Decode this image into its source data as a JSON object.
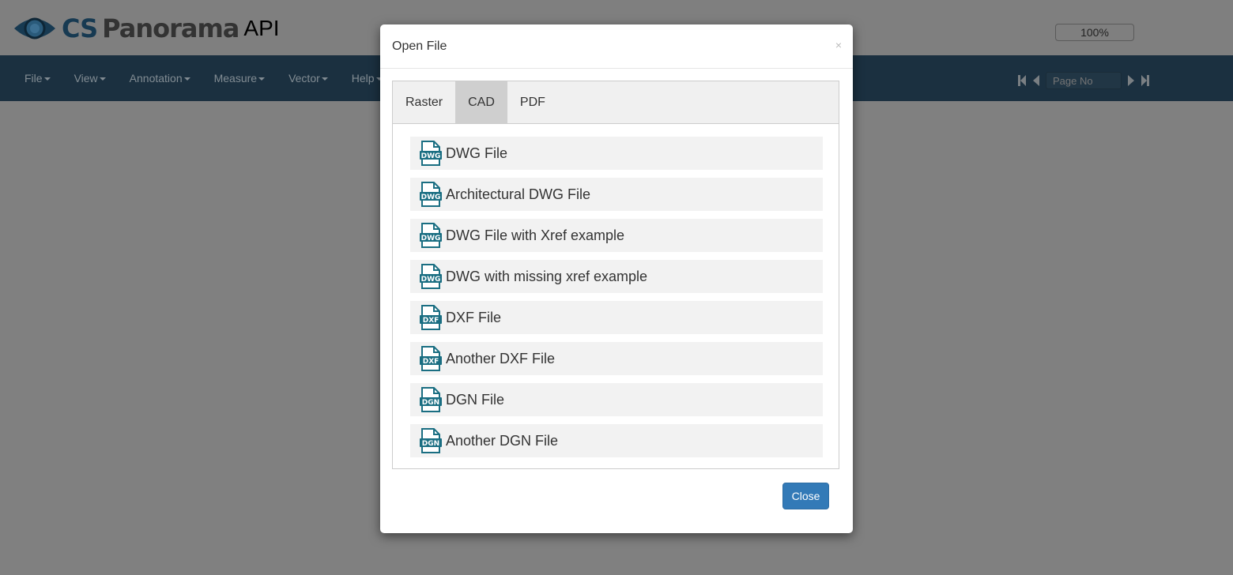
{
  "header": {
    "logo": {
      "cs": "CS",
      "panorama": "Panorama",
      "api": "API"
    },
    "zoom_level": "100%"
  },
  "navbar": {
    "menu": [
      {
        "label": "File"
      },
      {
        "label": "View"
      },
      {
        "label": "Annotation"
      },
      {
        "label": "Measure"
      },
      {
        "label": "Vector"
      },
      {
        "label": "Help"
      }
    ],
    "page_input_placeholder": "Page No"
  },
  "modal": {
    "title": "Open File",
    "close_symbol": "×",
    "tabs": [
      {
        "label": "Raster",
        "active": false
      },
      {
        "label": "CAD",
        "active": true
      },
      {
        "label": "PDF",
        "active": false
      }
    ],
    "files": [
      {
        "label": "DWG File",
        "icon": "DWG"
      },
      {
        "label": "Architectural DWG File",
        "icon": "DWG"
      },
      {
        "label": "DWG File with Xref example",
        "icon": "DWG"
      },
      {
        "label": "DWG with missing xref example",
        "icon": "DWG"
      },
      {
        "label": "DXF File",
        "icon": "DXF"
      },
      {
        "label": "Another DXF File",
        "icon": "DXF"
      },
      {
        "label": "DGN File",
        "icon": "DGN"
      },
      {
        "label": "Another DGN File",
        "icon": "DGN"
      }
    ],
    "close_button": "Close"
  },
  "colors": {
    "navbar": "#1b3040",
    "icon": "#1a6e82",
    "primary": "#337ab7"
  }
}
